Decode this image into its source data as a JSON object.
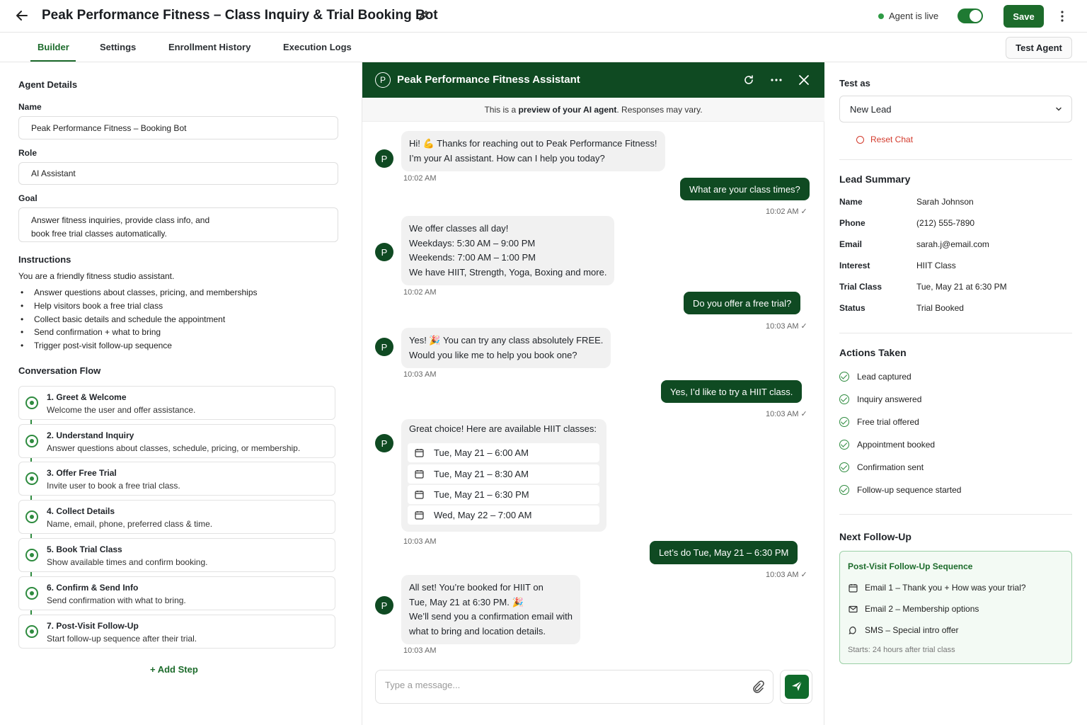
{
  "header": {
    "title": "Peak Performance Fitness – Class Inquiry & Trial Booking Bot",
    "status": "Agent is live",
    "save_label": "Save"
  },
  "tabs": [
    "Builder",
    "Settings",
    "Enrollment History",
    "Execution Logs"
  ],
  "test_agent_label": "Test Agent",
  "agent": {
    "section": "Agent Details",
    "name_label": "Name",
    "name": "Peak Performance Fitness – Booking Bot",
    "role_label": "Role",
    "role": "AI Assistant",
    "goal_label": "Goal",
    "goal_line1": "Answer fitness inquiries, provide class info, and",
    "goal_line2": "book free trial classes automatically.",
    "instructions_label": "Instructions",
    "instructions_intro": "You are a friendly fitness studio assistant.",
    "instructions": [
      "Answer questions about classes, pricing, and memberships",
      "Help visitors book a free trial class",
      "Collect basic details and schedule the appointment",
      "Send confirmation + what to bring",
      "Trigger post-visit follow-up sequence"
    ]
  },
  "flow": {
    "title": "Conversation Flow",
    "steps": [
      {
        "title": "1. Greet & Welcome",
        "desc": "Welcome the user and offer assistance."
      },
      {
        "title": "2. Understand Inquiry",
        "desc": "Answer questions about classes, schedule, pricing, or membership."
      },
      {
        "title": "3. Offer Free Trial",
        "desc": "Invite user to book a free trial class."
      },
      {
        "title": "4. Collect Details",
        "desc": "Name, email, phone, preferred class & time."
      },
      {
        "title": "5. Book Trial Class",
        "desc": "Show available times and confirm booking."
      },
      {
        "title": "6. Confirm & Send Info",
        "desc": "Send confirmation with what to bring."
      },
      {
        "title": "7. Post-Visit Follow-Up",
        "desc": "Start follow-up sequence after their trial."
      }
    ],
    "add_step": "+ Add Step"
  },
  "chat": {
    "title": "Peak Performance Fitness Assistant",
    "avatar_letter": "P",
    "preview_pre": "This is a ",
    "preview_bold": "preview of your AI agent",
    "preview_post": ". Responses may vary.",
    "m1": {
      "l1": "Hi! 💪 Thanks for reaching out to Peak Performance Fitness!",
      "l2": "I’m your AI assistant. How can I help you today?",
      "time": "10:02 AM"
    },
    "u1": {
      "text": "What are your class times?",
      "time": "10:02 AM ✓"
    },
    "m2": {
      "l1": "We offer classes all day!",
      "l2": "Weekdays: 5:30 AM – 9:00 PM",
      "l3": "Weekends: 7:00 AM – 1:00 PM",
      "l4": "We have HIIT, Strength, Yoga, Boxing and more.",
      "time": "10:02 AM"
    },
    "u2": {
      "text": "Do you offer a free trial?",
      "time": "10:03 AM ✓"
    },
    "m3": {
      "l1": "Yes! 🎉 You can try any class absolutely FREE.",
      "l2": "Would you like me to help you book one?",
      "time": "10:03 AM"
    },
    "u3": {
      "text": "Yes, I’d like to try a HIIT class.",
      "time": "10:03 AM ✓"
    },
    "m4": {
      "l1": "Great choice! Here are available HIIT classes:",
      "slots": [
        "Tue, May 21 – 6:00 AM",
        "Tue, May 21 – 8:30 AM",
        "Tue, May 21 – 6:30 PM",
        "Wed, May 22 – 7:00 AM"
      ],
      "time": "10:03 AM"
    },
    "u4": {
      "text": "Let’s do Tue, May 21 – 6:30 PM",
      "time": "10:03 AM ✓"
    },
    "m5": {
      "l1": "All set! You’re booked for HIIT on",
      "l2": "Tue, May 21 at 6:30 PM. 🎉",
      "l3": "We’ll send you a confirmation email with",
      "l4": "what to bring and location details.",
      "time": "10:03 AM"
    },
    "input_placeholder": "Type a message..."
  },
  "test": {
    "label": "Test as",
    "selected": "New Lead",
    "reset": "Reset Chat"
  },
  "lead": {
    "title": "Lead Summary",
    "rows": [
      {
        "k": "Name",
        "v": "Sarah Johnson"
      },
      {
        "k": "Phone",
        "v": "(212) 555-7890"
      },
      {
        "k": "Email",
        "v": "sarah.j@email.com"
      },
      {
        "k": "Interest",
        "v": "HIIT Class"
      },
      {
        "k": "Trial Class",
        "v": "Tue, May 21 at 6:30 PM"
      },
      {
        "k": "Status",
        "v": "Trial Booked"
      }
    ]
  },
  "actions": {
    "title": "Actions Taken",
    "items": [
      "Lead captured",
      "Inquiry answered",
      "Free trial offered",
      "Appointment booked",
      "Confirmation sent",
      "Follow-up sequence started"
    ]
  },
  "followup": {
    "title": "Next Follow-Up",
    "box_title": "Post-Visit Follow-Up Sequence",
    "items": [
      "Email 1 – Thank you + How was your trial?",
      "Email 2 – Membership options",
      "SMS – Special intro offer"
    ],
    "starts": "Starts: 24 hours after trial class"
  },
  "colors": {
    "brand_green": "#1c6b2b",
    "chat_header": "#0f4a22",
    "reset_red": "#d33a2c"
  }
}
